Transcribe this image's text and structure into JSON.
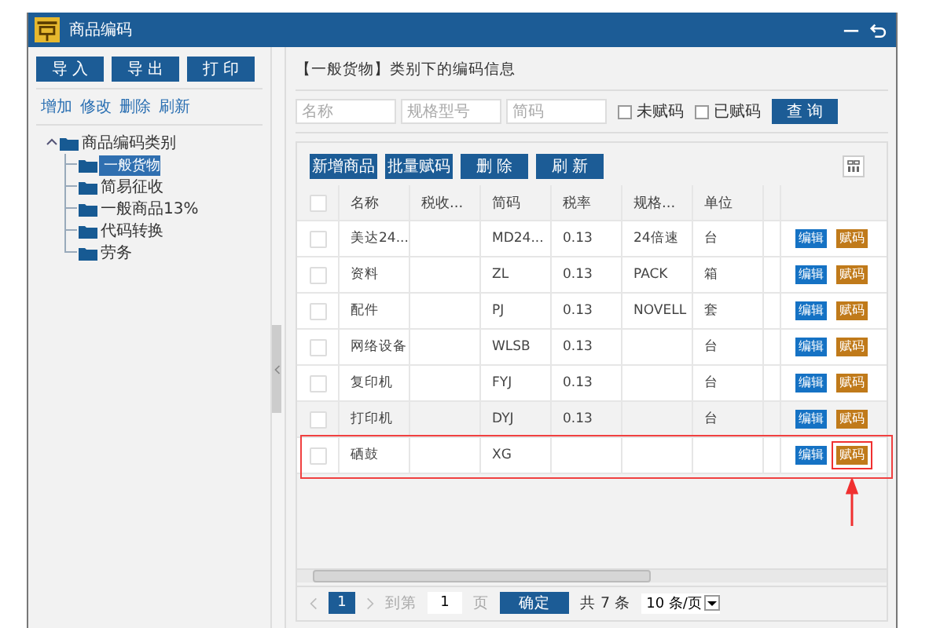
{
  "window": {
    "title": "商品编码"
  },
  "left_toolbar": [
    "导 入",
    "导 出",
    "打 印"
  ],
  "links": [
    "增加",
    "修改",
    "删除",
    "刷新"
  ],
  "tree": {
    "label": "商品编码类别",
    "expanded": true,
    "children": [
      {
        "label": "一般货物",
        "selected": true
      },
      {
        "label": "简易征收",
        "selected": false
      },
      {
        "label": "一般商品13%",
        "selected": false
      },
      {
        "label": "代码转换",
        "selected": false
      },
      {
        "label": "劳务",
        "selected": false
      }
    ]
  },
  "caption": "【一般货物】类别下的编码信息",
  "search": {
    "fields": [
      {
        "placeholder": "名称"
      },
      {
        "placeholder": "规格型号"
      },
      {
        "placeholder": "简码"
      }
    ],
    "filters": [
      {
        "label": "未赋码",
        "checked": false
      },
      {
        "label": "已赋码",
        "checked": false
      }
    ],
    "button": "查 询"
  },
  "toolbar": [
    "新增商品",
    "批量赋码",
    "删 除",
    "刷 新"
  ],
  "table": {
    "all_checked": false,
    "columns": [
      "名称",
      "税收...",
      "简码",
      "税率",
      "规格...",
      "单位"
    ],
    "rows": [
      {
        "cells": [
          "美达24...",
          "",
          "MD24...",
          "0.13",
          "24倍速",
          "台"
        ],
        "checked": false,
        "hovered": false,
        "highlighted": false,
        "edit": "编辑",
        "assign": "赋码"
      },
      {
        "cells": [
          "资料",
          "",
          "ZL",
          "0.13",
          "PACK",
          "箱"
        ],
        "checked": false,
        "hovered": false,
        "highlighted": false,
        "edit": "编辑",
        "assign": "赋码"
      },
      {
        "cells": [
          "配件",
          "",
          "PJ",
          "0.13",
          "NOVELL",
          "套"
        ],
        "checked": false,
        "hovered": false,
        "highlighted": false,
        "edit": "编辑",
        "assign": "赋码"
      },
      {
        "cells": [
          "网络设备",
          "",
          "WLSB",
          "0.13",
          "",
          "台"
        ],
        "checked": false,
        "hovered": false,
        "highlighted": false,
        "edit": "编辑",
        "assign": "赋码"
      },
      {
        "cells": [
          "复印机",
          "",
          "FYJ",
          "0.13",
          "",
          "台"
        ],
        "checked": false,
        "hovered": false,
        "highlighted": false,
        "edit": "编辑",
        "assign": "赋码"
      },
      {
        "cells": [
          "打印机",
          "",
          "DYJ",
          "0.13",
          "",
          "台"
        ],
        "checked": false,
        "hovered": true,
        "highlighted": false,
        "edit": "编辑",
        "assign": "赋码"
      },
      {
        "cells": [
          "硒鼓",
          "",
          "XG",
          "",
          "",
          ""
        ],
        "checked": false,
        "hovered": false,
        "highlighted": true,
        "edit": "编辑",
        "assign": "赋码"
      }
    ]
  },
  "pager": {
    "pages": [
      {
        "label": "1",
        "selected": true
      }
    ],
    "goto_label": "到第",
    "goto_value": "1",
    "page_unit": "页",
    "confirm": "确定",
    "total": "共 7 条",
    "page_size": "10 条/页"
  }
}
